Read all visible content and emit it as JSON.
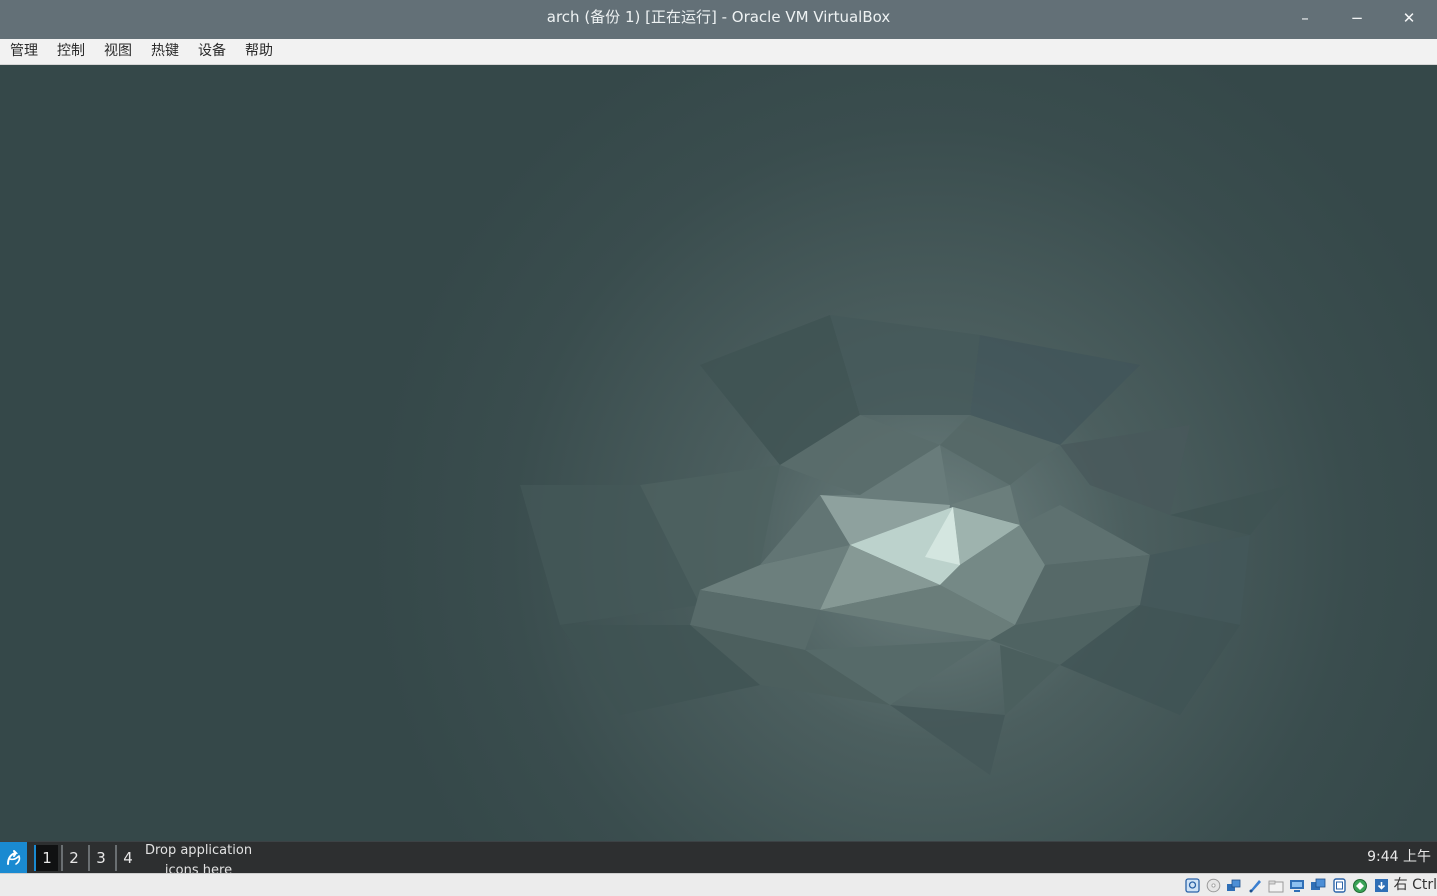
{
  "window": {
    "title": "arch (备份 1) [正在运行] - Oracle VM VirtualBox",
    "minimize_label": "–",
    "restore_label": "−",
    "close_label": "✕"
  },
  "menu": {
    "items": [
      {
        "label": "管理"
      },
      {
        "label": "控制"
      },
      {
        "label": "视图"
      },
      {
        "label": "热键"
      },
      {
        "label": "设备"
      },
      {
        "label": "帮助"
      }
    ]
  },
  "panel": {
    "start_icon": "xfce-menu-icon",
    "workspaces": [
      {
        "label": "1",
        "active": true
      },
      {
        "label": "2",
        "active": false
      },
      {
        "label": "3",
        "active": false
      },
      {
        "label": "4",
        "active": false
      }
    ],
    "drop_hint_line1": "Drop application",
    "drop_hint_line2": "icons here",
    "clock": "9:44 上午"
  },
  "statusbar": {
    "icons": [
      "hard-disk-icon",
      "optical-drive-icon",
      "audio-icon",
      "network-icon",
      "usb-icon",
      "shared-folder-icon",
      "display-icon",
      "video-capture-icon",
      "cpu-icon",
      "mouse-integration-icon",
      "keyboard-capture-icon"
    ],
    "host_key": "右 Ctrl"
  },
  "colors": {
    "titlebar": "#637077",
    "desktop": "#354849",
    "panel": "#2d2f30",
    "accent": "#1a8ad1"
  }
}
